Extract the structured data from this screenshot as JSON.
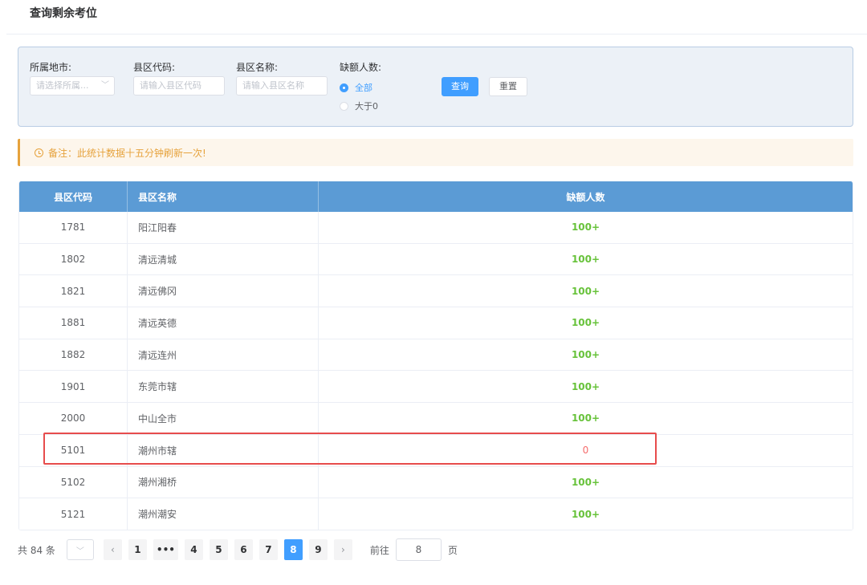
{
  "page": {
    "title": "查询剩余考位"
  },
  "filters": {
    "city": {
      "label": "所属地市:",
      "placeholder": "请选择所属..."
    },
    "county_code": {
      "label": "县区代码:",
      "placeholder": "请输入县区代码"
    },
    "county_name": {
      "label": "县区名称:",
      "placeholder": "请输入县区名称"
    },
    "shortage": {
      "label": "缺额人数:",
      "options": [
        "全部",
        "大于0"
      ],
      "selected": "全部"
    },
    "query_button": "查询",
    "reset_button": "重置"
  },
  "notice": {
    "text": "备注：此统计数据十五分钟刷新一次!"
  },
  "table": {
    "headers": [
      "县区代码",
      "县区名称",
      "缺额人数"
    ],
    "rows": [
      {
        "code": "1781",
        "name": "阳江阳春",
        "count": "100+"
      },
      {
        "code": "1802",
        "name": "清远清城",
        "count": "100+"
      },
      {
        "code": "1821",
        "name": "清远佛冈",
        "count": "100+"
      },
      {
        "code": "1881",
        "name": "清远英德",
        "count": "100+"
      },
      {
        "code": "1882",
        "name": "清远连州",
        "count": "100+"
      },
      {
        "code": "1901",
        "name": "东莞市辖",
        "count": "100+"
      },
      {
        "code": "2000",
        "name": "中山全市",
        "count": "100+"
      },
      {
        "code": "5101",
        "name": "潮州市辖",
        "count": "0"
      },
      {
        "code": "5102",
        "name": "潮州湘桥",
        "count": "100+"
      },
      {
        "code": "5121",
        "name": "潮州潮安",
        "count": "100+"
      }
    ]
  },
  "pagination": {
    "total": "共 84 条",
    "prev": "‹",
    "next": "›",
    "pages": [
      "1",
      "•••",
      "4",
      "5",
      "6",
      "7",
      "8",
      "9"
    ],
    "current": "8",
    "goto_label": "前往",
    "goto_value": "8",
    "page_unit": "页"
  },
  "colors": {
    "accent": "#409eff",
    "header": "#5b9bd5",
    "ok": "#67c23a",
    "zero": "#f56c6c",
    "warning": "#e6a23c"
  }
}
